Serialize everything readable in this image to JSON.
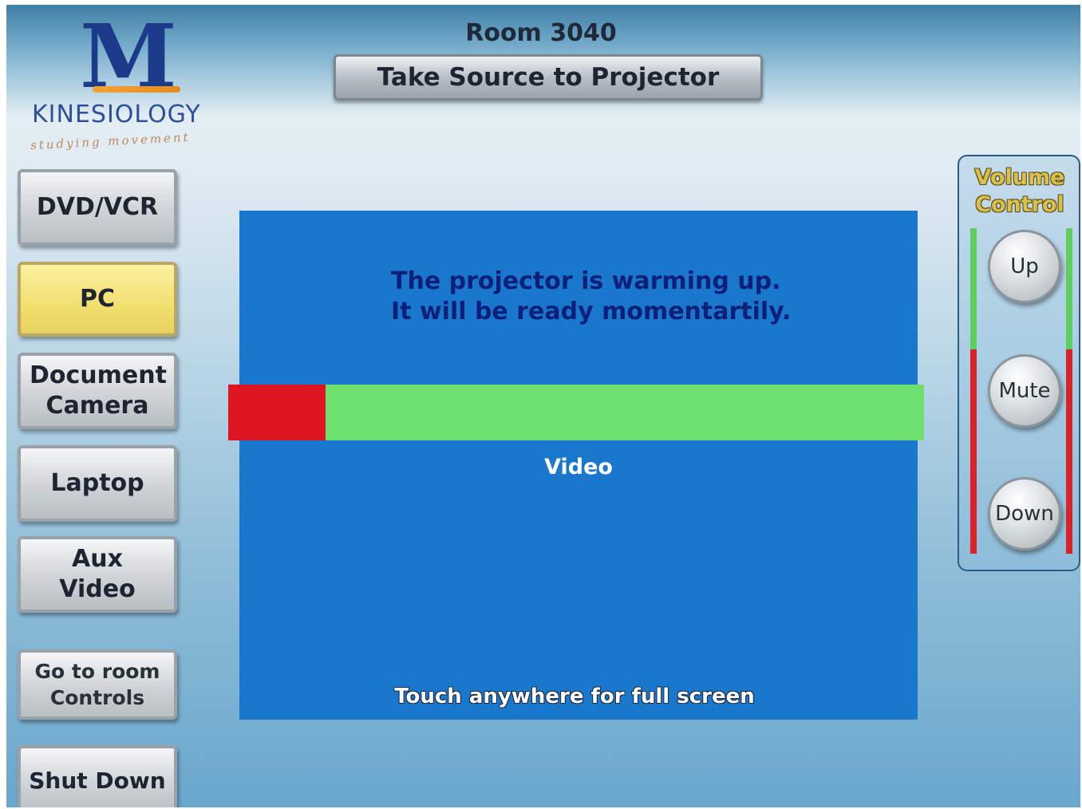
{
  "logo": {
    "letter": "M",
    "text": "KINESIOLOGY",
    "tagline": "studying movement"
  },
  "header": {
    "room": "Room 3040",
    "take_source": "Take Source to Projector"
  },
  "sources": {
    "dvd": "DVD/VCR",
    "pc": "PC",
    "document_camera": "Document Camera",
    "laptop": "Laptop",
    "aux_video": "Aux Video",
    "room_controls": "Go to room Controls",
    "shut_down": "Shut Down"
  },
  "selected_source": "PC",
  "main": {
    "message_line1": "The projector is warming up.",
    "message_line2": "It will be ready momentartily.",
    "warmup_progress_percent": 14,
    "input_label": "Video",
    "touch_hint": "Touch anywhere for full screen"
  },
  "volume": {
    "title_line1": "Volume",
    "title_line2": "Control",
    "up": "Up",
    "mute": "Mute",
    "down": "Down"
  },
  "colors": {
    "panel_blue": "#1a78cc",
    "progress_red": "#dd1520",
    "progress_green": "#6ee06e",
    "active_yellow": "#f1df6e"
  }
}
